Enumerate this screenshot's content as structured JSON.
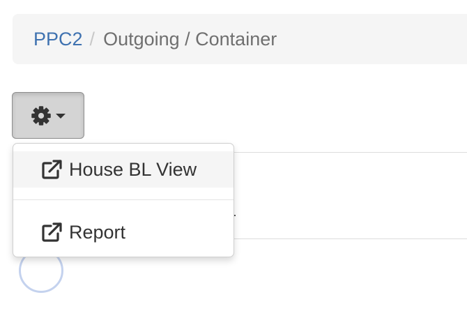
{
  "breadcrumb": {
    "items": [
      {
        "label": "PPC2",
        "link": true
      },
      {
        "label": "Outgoing / Container",
        "link": false
      }
    ],
    "separator": "/"
  },
  "toolbar": {
    "settings_button": {
      "icon": "gear-icon",
      "indicator": "caret-down-icon",
      "state": "pressed"
    }
  },
  "dropdown_menu": {
    "items": [
      {
        "label": "House BL View",
        "icon": "external-link-icon",
        "highlighted": true
      },
      {
        "label": "Report",
        "icon": "external-link-icon",
        "highlighted": false
      }
    ]
  },
  "colors": {
    "link": "#3f72b0",
    "breadcrumb_bg": "#f5f5f5",
    "button_active_bg": "#d4d4d4",
    "menu_highlight": "#f5f5f5",
    "spinner": "#c4d2ee"
  }
}
